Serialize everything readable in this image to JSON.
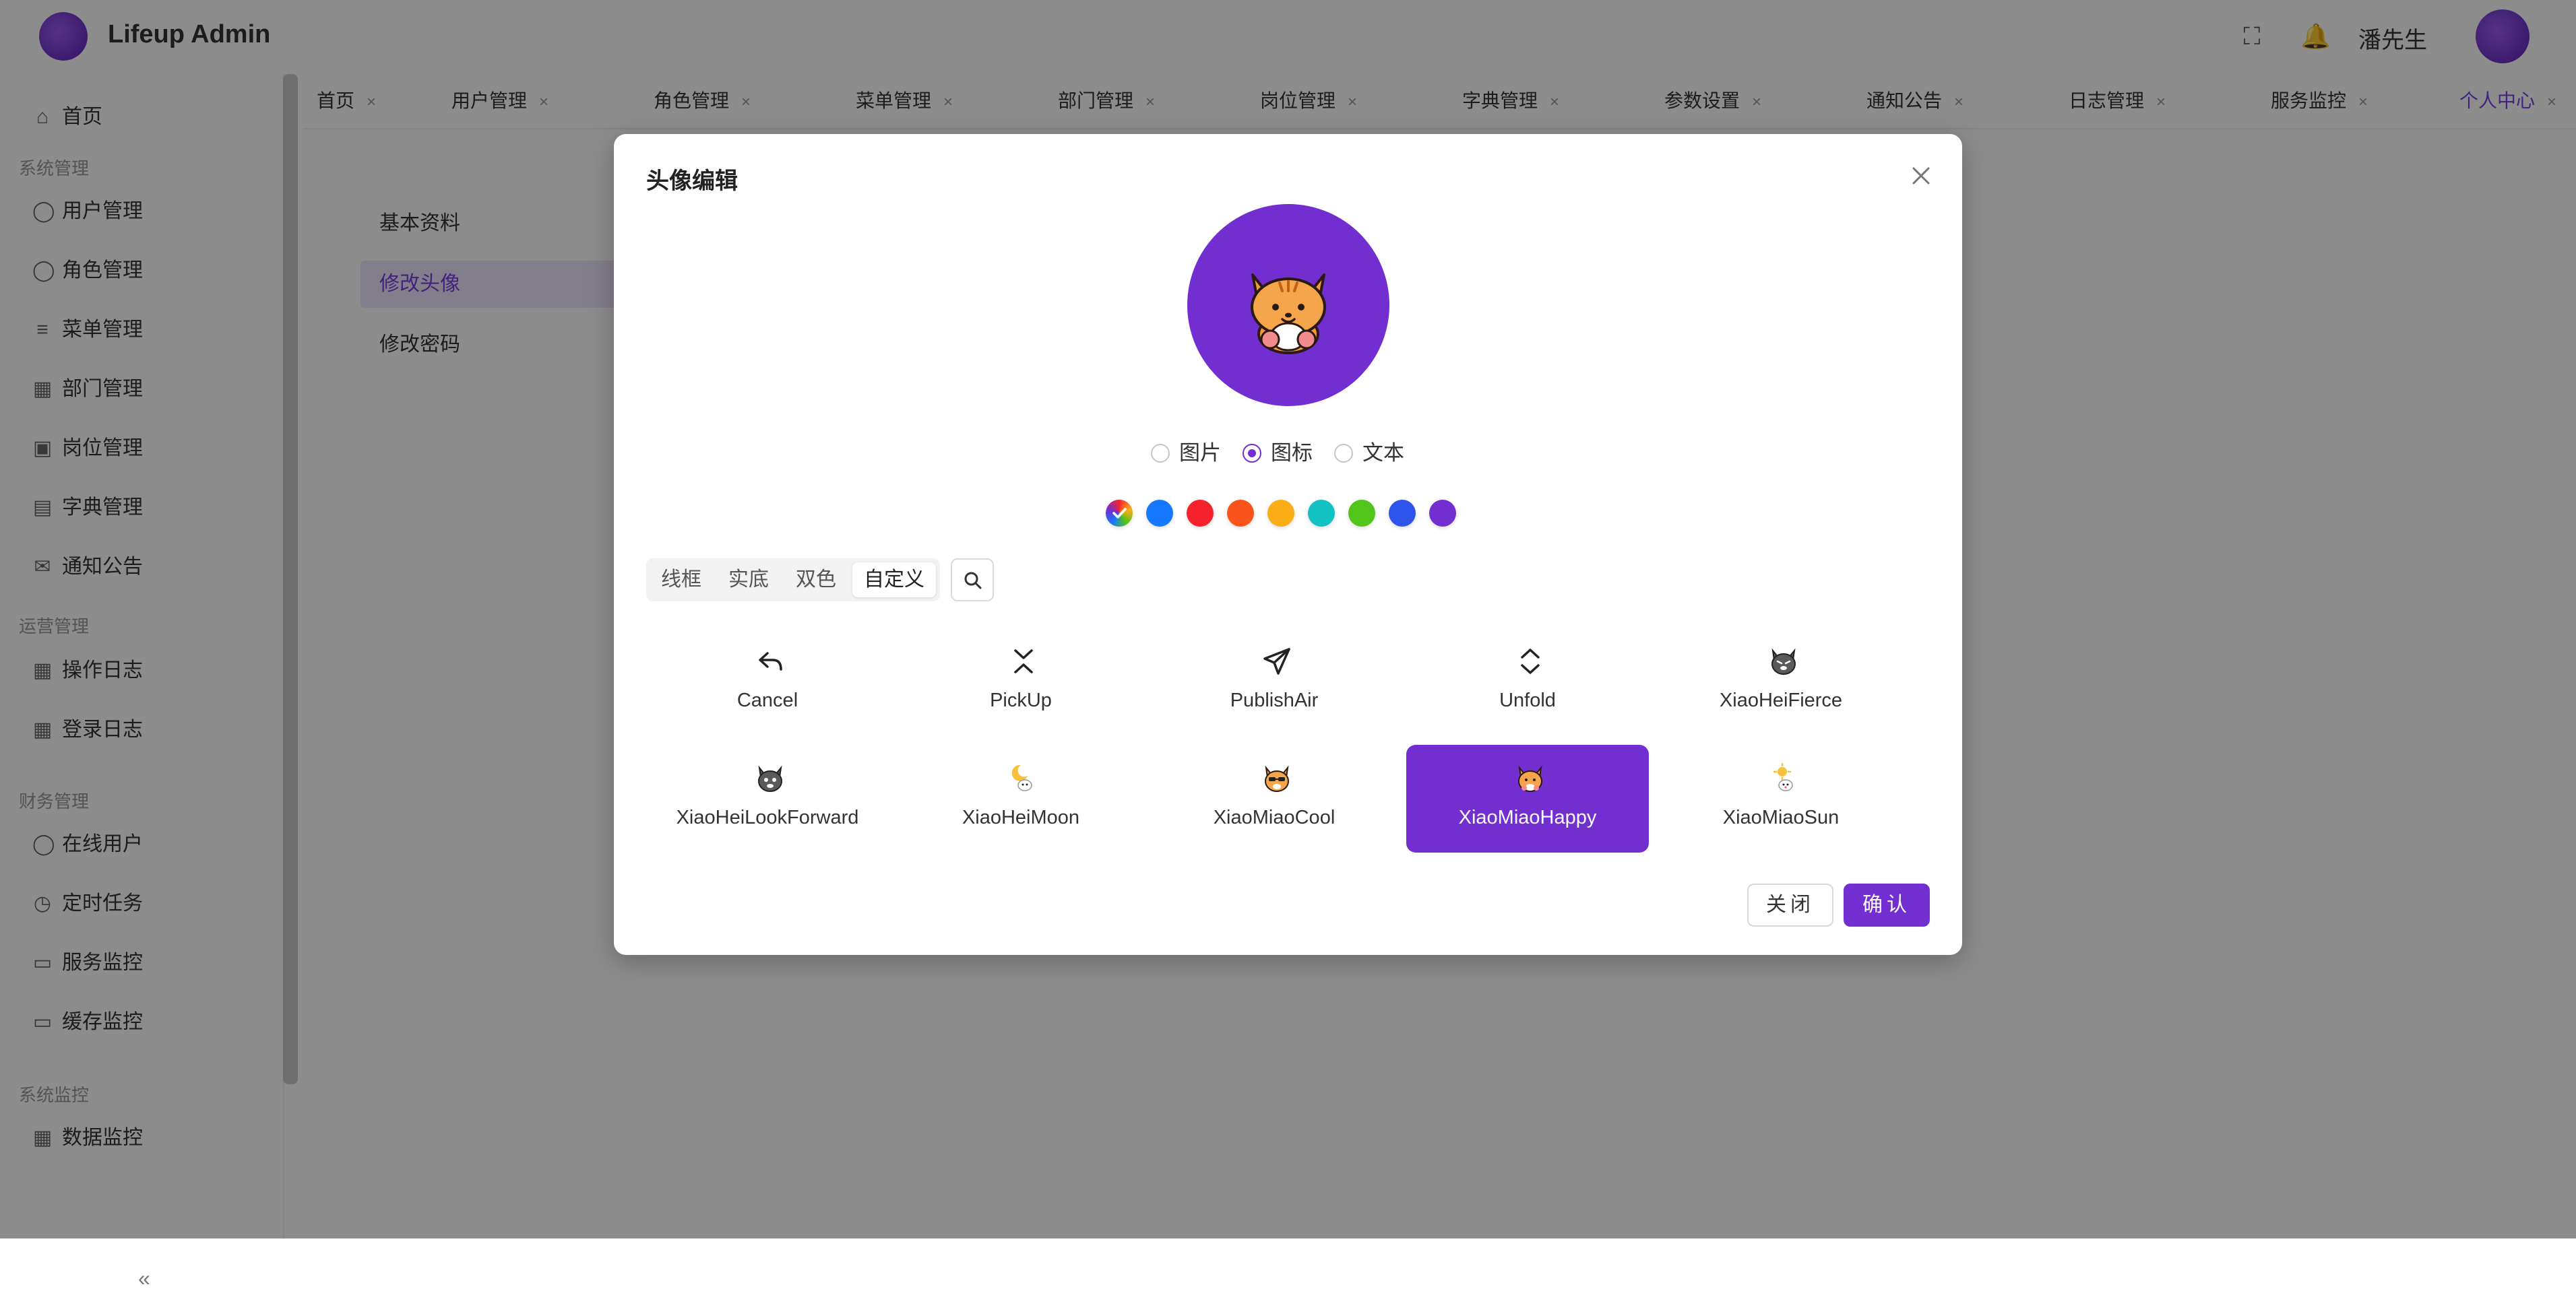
{
  "app": {
    "title": "Lifeup Admin",
    "user_name": "潘先生",
    "sidebar": {
      "groups": [
        "系统管理",
        "运营管理",
        "财务管理",
        "系统监控"
      ],
      "items": [
        {
          "label": "首页"
        },
        {
          "label": "用户管理"
        },
        {
          "label": "角色管理"
        },
        {
          "label": "菜单管理"
        },
        {
          "label": "部门管理"
        },
        {
          "label": "岗位管理"
        },
        {
          "label": "字典管理"
        },
        {
          "label": "通知公告"
        },
        {
          "label": "操作日志"
        },
        {
          "label": "登录日志"
        },
        {
          "label": "在线用户"
        },
        {
          "label": "定时任务"
        },
        {
          "label": "服务监控"
        },
        {
          "label": "缓存监控"
        },
        {
          "label": "数据监控"
        }
      ]
    },
    "tabs": [
      {
        "label": "首页"
      },
      {
        "label": "用户管理"
      },
      {
        "label": "角色管理"
      },
      {
        "label": "菜单管理"
      },
      {
        "label": "部门管理"
      },
      {
        "label": "岗位管理"
      },
      {
        "label": "字典管理"
      },
      {
        "label": "参数设置"
      },
      {
        "label": "通知公告"
      },
      {
        "label": "日志管理"
      },
      {
        "label": "服务监控"
      },
      {
        "label": "个人中心"
      }
    ],
    "content_menu": [
      "基本资料",
      "修改头像",
      "修改密码"
    ]
  },
  "modal": {
    "title": "头像编辑",
    "preview_icon": "XiaoMiaoHappy",
    "preview_bg": "#722ed1",
    "types": [
      {
        "label": "图片",
        "checked": false
      },
      {
        "label": "图标",
        "checked": true
      },
      {
        "label": "文本",
        "checked": false
      }
    ],
    "colors": [
      "#1677ff",
      "#f5222d",
      "#fa541c",
      "#faad14",
      "#13c2c2",
      "#52c41a",
      "#2f54eb",
      "#722ed1"
    ],
    "icon_styles": [
      {
        "label": "线框",
        "active": false
      },
      {
        "label": "实底",
        "active": false
      },
      {
        "label": "双色",
        "active": false
      },
      {
        "label": "自定义",
        "active": true
      }
    ],
    "icons": [
      {
        "label": "Cancel",
        "icon": "cancel-icon",
        "selected": false
      },
      {
        "label": "PickUp",
        "icon": "pickup-icon",
        "selected": false
      },
      {
        "label": "PublishAir",
        "icon": "publish-air-icon",
        "selected": false
      },
      {
        "label": "Unfold",
        "icon": "unfold-icon",
        "selected": false
      },
      {
        "label": "XiaoHeiFierce",
        "icon": "black-cat-fierce-icon",
        "selected": false
      },
      {
        "label": "XiaoHeiLookForward",
        "icon": "black-cat-lookforward-icon",
        "selected": false
      },
      {
        "label": "XiaoHeiMoon",
        "icon": "black-cat-moon-icon",
        "selected": false
      },
      {
        "label": "XiaoMiaoCool",
        "icon": "tabby-cat-cool-icon",
        "selected": false
      },
      {
        "label": "XiaoMiaoHappy",
        "icon": "tabby-cat-happy-icon",
        "selected": true
      },
      {
        "label": "XiaoMiaoSun",
        "icon": "tabby-cat-sun-icon",
        "selected": false
      }
    ],
    "close_label": "关闭",
    "confirm_label": "确认"
  }
}
